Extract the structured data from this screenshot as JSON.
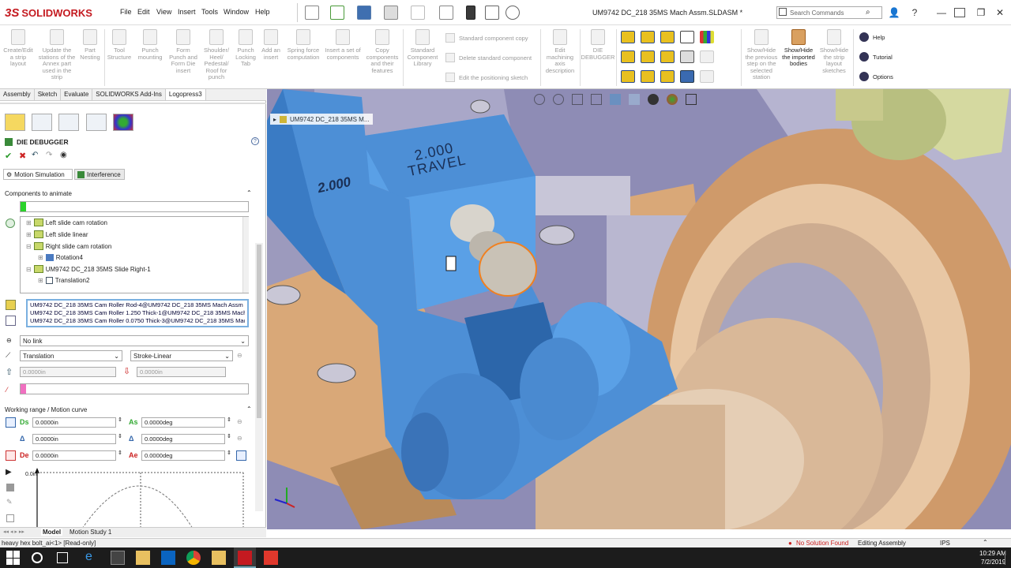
{
  "app": {
    "brand_ds": "3S",
    "brand": "SOLIDWORKS",
    "document_title": "UM9742 DC_218 35MS Mach Assm.SLDASM *"
  },
  "menu": [
    "File",
    "Edit",
    "View",
    "Insert",
    "Tools",
    "Window",
    "Help"
  ],
  "search": {
    "placeholder": "Search Commands"
  },
  "ribbon": {
    "buttons": [
      "Create/Edit a strip layout",
      "Update the stations of the Annex part used in the strip",
      "Part Nesting",
      "Tool Structure",
      "Punch mounting",
      "Form Punch and Form Die insert",
      "Shoulder/ Heel/ Pedestal/ Roof for punch",
      "Punch Locking Tab",
      "Add an insert",
      "Spring force computation",
      "Insert a set of components",
      "Copy components and their features",
      "Standard Component Library"
    ],
    "small_actions": [
      "Standard component copy",
      "Delete standard component",
      "Edit the positioning sketch"
    ],
    "buttons2": [
      "Edit machining axis description",
      "DIE DEBUGGER"
    ],
    "right_buttons": [
      "Show/Hide the previous step on the selected station",
      "Show/Hide the imported bodies",
      "Show/Hide the strip layout sketches"
    ],
    "help_links": [
      "Help",
      "Tutorial",
      "Options"
    ]
  },
  "cmd_tabs": [
    "Assembly",
    "Sketch",
    "Evaluate",
    "SOLIDWORKS Add-Ins",
    "Logopress3"
  ],
  "panel": {
    "title": "DIE DEBUGGER",
    "subtabs": [
      "Motion Simulation",
      "Interference"
    ],
    "section_components": "Components to animate",
    "tree": [
      {
        "label": "Left slide cam rotation",
        "indent": 1
      },
      {
        "label": "Left slide linear",
        "indent": 1
      },
      {
        "label": "Right slide cam rotation",
        "indent": 1
      },
      {
        "label": "Rotation4",
        "indent": 2
      },
      {
        "label": "UM9742 DC_218 35MS Slide Right-1",
        "indent": 1
      },
      {
        "label": "Translation2",
        "indent": 2
      }
    ],
    "selected_components": [
      "UM9742 DC_218 35MS Cam Roller Rod-4@UM9742 DC_218 35MS Mach Assm",
      "UM9742 DC_218 35MS Cam Roller 1.250 Thick-1@UM9742 DC_218 35MS Mach",
      "UM9742 DC_218 35MS Cam Roller 0.0750 Thick-3@UM9742 DC_218 35MS Mac"
    ],
    "link": "No link",
    "motion_type": "Translation",
    "motion_curve": "Stroke-Linear",
    "distance_value": "0.0000in",
    "distance_value2": "0.0000in",
    "section_working": "Working range / Motion curve",
    "params": [
      {
        "label": "Ds",
        "value": "0.0000in",
        "label2": "As",
        "value2": "0.0000deg"
      },
      {
        "label": "Δ",
        "value": "0.0000in",
        "label2": "Δ",
        "value2": "0.0000deg"
      },
      {
        "label": "De",
        "value": "0.0000in",
        "label2": "Ae",
        "value2": "0.0000deg"
      }
    ],
    "graph_label": "0.0in"
  },
  "viewport": {
    "breadcrumb": "UM9742 DC_218 35MS M...",
    "engraving_line1": "2.000",
    "engraving_line2": "TRAVEL"
  },
  "bottom_tabs": [
    "Model",
    "Motion Study 1"
  ],
  "status": {
    "left": "heavy hex bolt_ai<1> [Read-only]",
    "solution": "No Solution Found",
    "mode": "Editing Assembly",
    "units": "IPS"
  },
  "taskbar": {
    "time": "10:29 AM",
    "date": "7/2/2019"
  },
  "colors": {
    "blue_part": "#4d8fd6",
    "tan_part": "#d9a878",
    "viewport_bg": "#8e8cb5"
  }
}
